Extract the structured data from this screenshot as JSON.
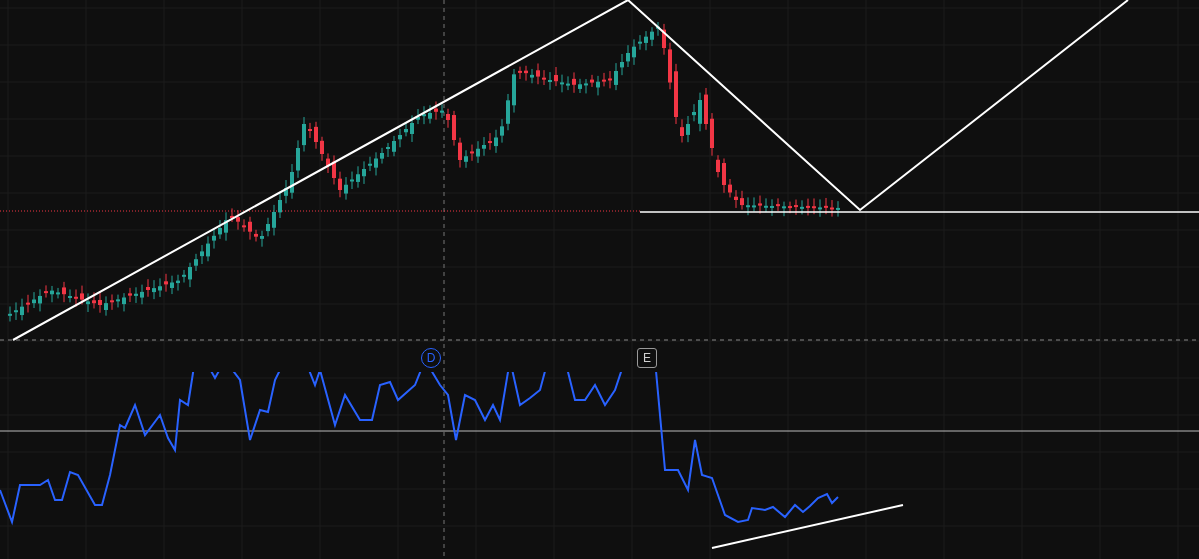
{
  "event_markers": [
    {
      "label": "D",
      "kind": "dividend"
    },
    {
      "label": "E",
      "kind": "earnings"
    }
  ]
}
